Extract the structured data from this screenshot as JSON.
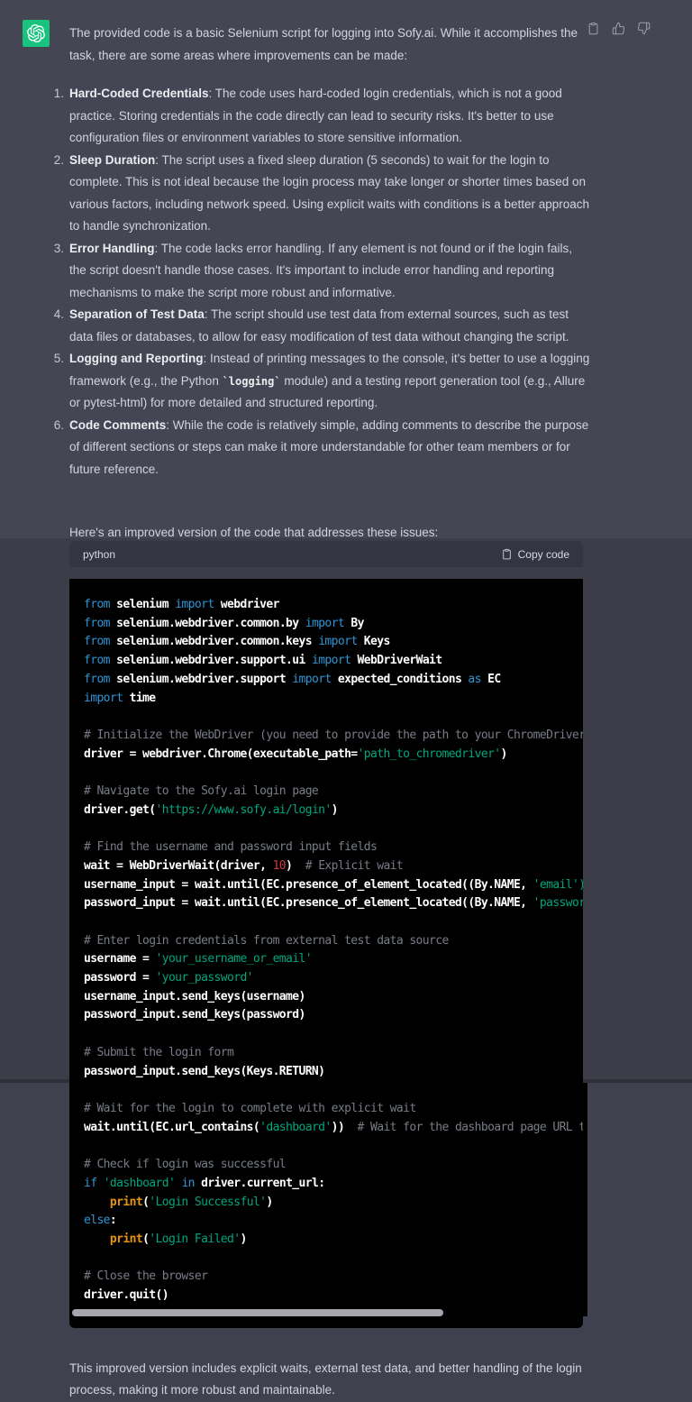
{
  "colors": {
    "accent": "#19C37D",
    "kw": "#2E95D3",
    "str": "#00A67D",
    "num": "#D0383E",
    "builtin": "#E9950C",
    "comment": "#787C87"
  },
  "message": {
    "intro": "The provided code is a basic Selenium script for logging into Sofy.ai. While it accomplishes the task, there are some areas where improvements can be made:",
    "items": [
      {
        "segments": [
          {
            "b": "Hard-Coded Credentials"
          },
          {
            "t": ": The code uses hard-coded login credentials, which is not a good practice. Storing credentials in the code directly can lead to security risks. It's better to use configuration files or environment variables to store sensitive information."
          }
        ]
      },
      {
        "segments": [
          {
            "b": "Sleep Duration"
          },
          {
            "t": ": The script uses a fixed sleep duration (5 seconds) to wait for the login to complete. This is not ideal because the login process may take longer or shorter times based on various factors, including network speed. Using explicit waits with conditions is a better approach to handle synchronization."
          }
        ]
      },
      {
        "segments": [
          {
            "b": "Error Handling"
          },
          {
            "t": ": The code lacks error handling. If any element is not found or if the login fails, the script doesn't handle those cases. It's important to include error handling and reporting mechanisms to make the script more robust and informative."
          }
        ]
      },
      {
        "segments": [
          {
            "b": "Separation of Test Data"
          },
          {
            "t": ": The script should use test data from external sources, such as test data files or databases, to allow for easy modification of test data without changing the script."
          }
        ]
      },
      {
        "segments": [
          {
            "b": "Logging and Reporting"
          },
          {
            "t": ": Instead of printing messages to the console, it's better to use a logging framework (e.g., the Python "
          },
          {
            "code": "`logging`"
          },
          {
            "t": " module) and a testing report generation tool (e.g., Allure or pytest-html) for more detailed and structured reporting."
          }
        ]
      },
      {
        "segments": [
          {
            "b": "Code Comments"
          },
          {
            "t": ": While the code is relatively simple, adding comments to describe the purpose of different sections or steps can make it more understandable for other team members or for future reference."
          }
        ]
      }
    ],
    "pre_code_text": "Here's an improved version of the code that addresses these issues:",
    "closing": "This improved version includes explicit waits, external test data, and better handling of the login process, making it more robust and maintainable."
  },
  "code_block": {
    "language": "python",
    "copy_label": "Copy code",
    "lines": [
      [
        [
          "k",
          "from"
        ],
        [
          "p",
          " selenium "
        ],
        [
          "k",
          "import"
        ],
        [
          "p",
          " webdriver"
        ]
      ],
      [
        [
          "k",
          "from"
        ],
        [
          "p",
          " selenium.webdriver.common.by "
        ],
        [
          "k",
          "import"
        ],
        [
          "p",
          " By"
        ]
      ],
      [
        [
          "k",
          "from"
        ],
        [
          "p",
          " selenium.webdriver.common.keys "
        ],
        [
          "k",
          "import"
        ],
        [
          "p",
          " Keys"
        ]
      ],
      [
        [
          "k",
          "from"
        ],
        [
          "p",
          " selenium.webdriver.support.ui "
        ],
        [
          "k",
          "import"
        ],
        [
          "p",
          " WebDriverWait"
        ]
      ],
      [
        [
          "k",
          "from"
        ],
        [
          "p",
          " selenium.webdriver.support "
        ],
        [
          "k",
          "import"
        ],
        [
          "p",
          " expected_conditions "
        ],
        [
          "k",
          "as"
        ],
        [
          "p",
          " EC"
        ]
      ],
      [
        [
          "k",
          "import"
        ],
        [
          "p",
          " time"
        ]
      ],
      [],
      [
        [
          "c",
          "# Initialize the WebDriver (you need to provide the path to your ChromeDriver)"
        ]
      ],
      [
        [
          "p",
          "driver = webdriver.Chrome(executable_path="
        ],
        [
          "s",
          "'path_to_chromedriver'"
        ],
        [
          "p",
          ")"
        ]
      ],
      [],
      [
        [
          "c",
          "# Navigate to the Sofy.ai login page"
        ]
      ],
      [
        [
          "p",
          "driver.get("
        ],
        [
          "s",
          "'https://www.sofy.ai/login'"
        ],
        [
          "p",
          ")"
        ]
      ],
      [],
      [
        [
          "c",
          "# Find the username and password input fields"
        ]
      ],
      [
        [
          "p",
          "wait = WebDriverWait(driver, "
        ],
        [
          "n",
          "10"
        ],
        [
          "p",
          ")  "
        ],
        [
          "c",
          "# Explicit wait"
        ]
      ],
      [
        [
          "p",
          "username_input = wait.until(EC.presence_of_element_located((By.NAME, "
        ],
        [
          "s",
          "'email')))"
        ]
      ],
      [
        [
          "p",
          "password_input = wait.until(EC.presence_of_element_located((By.NAME, "
        ],
        [
          "s",
          "'password')))"
        ]
      ],
      [],
      [
        [
          "c",
          "# Enter login credentials from external test data source"
        ]
      ],
      [
        [
          "p",
          "username = "
        ],
        [
          "s",
          "'your_username_or_email'"
        ]
      ],
      [
        [
          "p",
          "password = "
        ],
        [
          "s",
          "'your_password'"
        ]
      ],
      [
        [
          "p",
          "username_input.send_keys(username)"
        ]
      ],
      [
        [
          "p",
          "password_input.send_keys(password)"
        ]
      ],
      [],
      [
        [
          "c",
          "# Submit the login form"
        ]
      ],
      [
        [
          "p",
          "password_input.send_keys(Keys.RETURN)"
        ]
      ],
      [],
      [
        [
          "c",
          "# Wait for the login to complete with explicit wait"
        ]
      ],
      [
        [
          "p",
          "wait.until(EC.url_contains("
        ],
        [
          "s",
          "'dashboard'"
        ],
        [
          "p",
          "))  "
        ],
        [
          "c",
          "# Wait for the dashboard page URL to load"
        ]
      ],
      [],
      [
        [
          "c",
          "# Check if login was successful"
        ]
      ],
      [
        [
          "k",
          "if"
        ],
        [
          "p",
          " "
        ],
        [
          "s",
          "'dashboard'"
        ],
        [
          "p",
          " "
        ],
        [
          "k",
          "in"
        ],
        [
          "p",
          " driver.current_url:"
        ]
      ],
      [
        [
          "p",
          "    "
        ],
        [
          "b",
          "print"
        ],
        [
          "p",
          "("
        ],
        [
          "s",
          "'Login Successful'"
        ],
        [
          "p",
          ")"
        ]
      ],
      [
        [
          "k",
          "else"
        ],
        [
          "p",
          ":"
        ]
      ],
      [
        [
          "p",
          "    "
        ],
        [
          "b",
          "print"
        ],
        [
          "p",
          "("
        ],
        [
          "s",
          "'Login Failed'"
        ],
        [
          "p",
          ")"
        ]
      ],
      [],
      [
        [
          "c",
          "# Close the browser"
        ]
      ],
      [
        [
          "p",
          "driver.quit()"
        ]
      ]
    ]
  }
}
